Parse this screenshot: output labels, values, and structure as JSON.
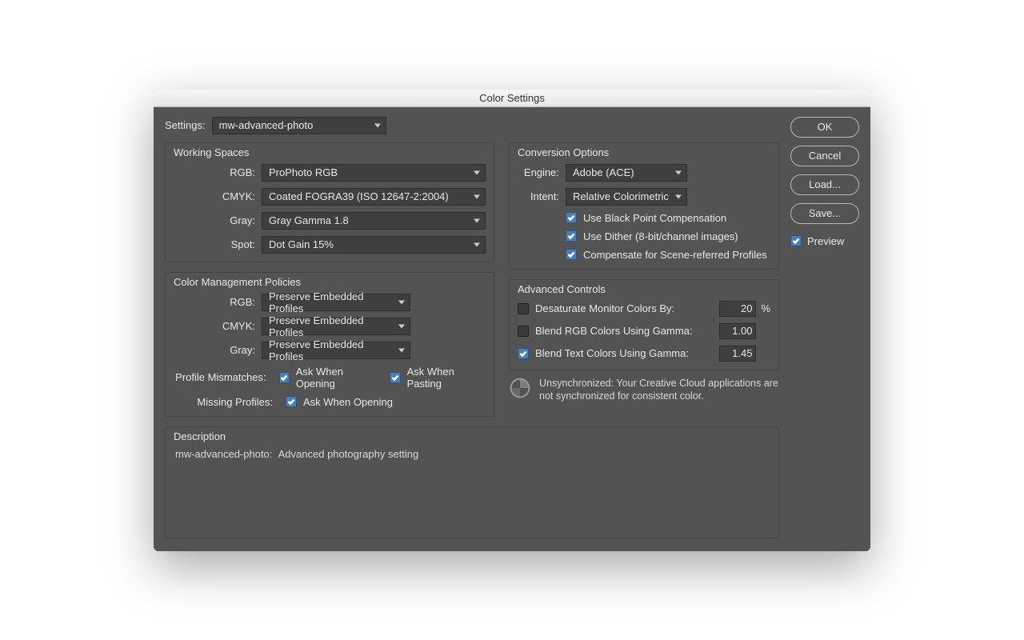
{
  "title": "Color Settings",
  "settingsLabel": "Settings:",
  "settingsValue": "mw-advanced-photo",
  "workingSpaces": {
    "legend": "Working Spaces",
    "rgbLabel": "RGB:",
    "rgbValue": "ProPhoto RGB",
    "cmykLabel": "CMYK:",
    "cmykValue": "Coated FOGRA39 (ISO 12647-2:2004)",
    "grayLabel": "Gray:",
    "grayValue": "Gray Gamma 1.8",
    "spotLabel": "Spot:",
    "spotValue": "Dot Gain 15%"
  },
  "policies": {
    "legend": "Color Management Policies",
    "rgbLabel": "RGB:",
    "rgbValue": "Preserve Embedded Profiles",
    "cmykLabel": "CMYK:",
    "cmykValue": "Preserve Embedded Profiles",
    "grayLabel": "Gray:",
    "grayValue": "Preserve Embedded Profiles",
    "mismatchLabel": "Profile Mismatches:",
    "askOpening": "Ask When Opening",
    "askPasting": "Ask When Pasting",
    "missingLabel": "Missing Profiles:"
  },
  "conversion": {
    "legend": "Conversion Options",
    "engineLabel": "Engine:",
    "engineValue": "Adobe (ACE)",
    "intentLabel": "Intent:",
    "intentValue": "Relative Colorimetric",
    "blackPoint": "Use Black Point Compensation",
    "dither": "Use Dither (8-bit/channel images)",
    "sceneReferred": "Compensate for Scene-referred Profiles"
  },
  "advanced": {
    "legend": "Advanced Controls",
    "desat": "Desaturate Monitor Colors By:",
    "desatVal": "20",
    "pct": "%",
    "blendRgb": "Blend RGB Colors Using Gamma:",
    "blendRgbVal": "1.00",
    "blendText": "Blend Text Colors Using Gamma:",
    "blendTextVal": "1.45"
  },
  "unsync": "Unsynchronized: Your Creative Cloud applications are not synchronized for consistent color.",
  "description": {
    "legend": "Description",
    "name": "mw-advanced-photo:",
    "text": "Advanced photography setting"
  },
  "buttons": {
    "ok": "OK",
    "cancel": "Cancel",
    "load": "Load...",
    "save": "Save..."
  },
  "preview": "Preview"
}
